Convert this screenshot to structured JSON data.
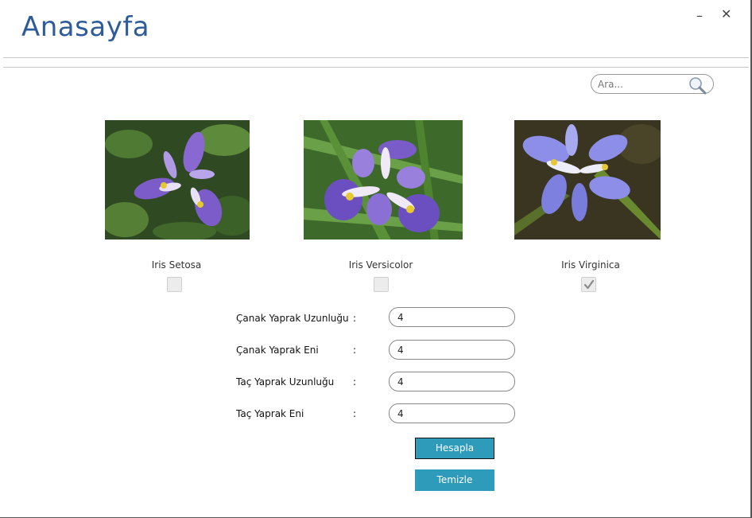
{
  "window": {
    "title": "Anasayfa",
    "minimize_glyph": "–",
    "close_glyph": "✕"
  },
  "search": {
    "placeholder": "Ara...",
    "icon": "search-icon"
  },
  "flowers": [
    {
      "name": "Iris Setosa",
      "checked": false
    },
    {
      "name": "Iris Versicolor",
      "checked": false
    },
    {
      "name": "Iris Virginica",
      "checked": true
    }
  ],
  "form": {
    "fields": [
      {
        "label": "Çanak Yaprak Uzunluğu",
        "colon": ":",
        "value": "4"
      },
      {
        "label": "Çanak Yaprak Eni",
        "colon": ":",
        "value": "4"
      },
      {
        "label": "Taç Yaprak Uzunluğu",
        "colon": ":",
        "value": "4"
      },
      {
        "label": "Taç Yaprak Eni",
        "colon": ":",
        "value": "4"
      }
    ]
  },
  "buttons": {
    "calculate": "Hesapla",
    "clear": "Temizle"
  },
  "colors": {
    "title": "#2e5c9a",
    "button": "#2e9bbb"
  }
}
